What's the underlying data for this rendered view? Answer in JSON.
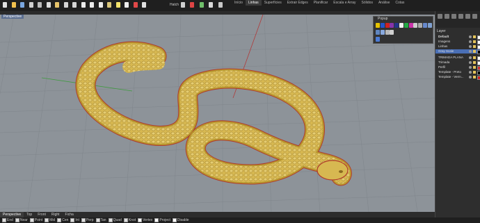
{
  "toolbar": {
    "hatch_label": "Hatch",
    "icons": [
      {
        "name": "new-icon",
        "color": "#e0e0e0"
      },
      {
        "name": "open-icon",
        "color": "#f2c14e"
      },
      {
        "name": "save-icon",
        "color": "#7aa7e0"
      },
      {
        "name": "print-icon",
        "color": "#cfcfcf"
      },
      {
        "name": "cut-icon",
        "color": "#bbbbbb"
      },
      {
        "name": "copy-icon",
        "color": "#dddddd"
      },
      {
        "name": "paste-icon",
        "color": "#e6c36a"
      },
      {
        "name": "undo-icon",
        "color": "#d6d6d6"
      },
      {
        "name": "redo-icon",
        "color": "#d6d6d6"
      },
      {
        "name": "pan-icon",
        "color": "#eaeaea"
      },
      {
        "name": "rotate-icon",
        "color": "#eaeaea"
      },
      {
        "name": "zoom-icon",
        "color": "#eaeaea"
      },
      {
        "name": "select-icon",
        "color": "#d9c67a"
      },
      {
        "name": "light-icon",
        "color": "#f4e36b"
      },
      {
        "name": "properties-icon",
        "color": "#eeeeee"
      },
      {
        "name": "record-icon",
        "color": "#e04848"
      },
      {
        "name": "layer-icon",
        "color": "#e0e0e0"
      },
      {
        "name": "box-icon",
        "color": "#cfcfcf"
      },
      {
        "name": "material-icon",
        "color": "#dd4444"
      },
      {
        "name": "render-icon",
        "color": "#6fbf6a"
      },
      {
        "name": "gumball-icon",
        "color": "#d9d9d9"
      },
      {
        "name": "settings-icon",
        "color": "#c8c8c8"
      }
    ]
  },
  "menu_tabs": [
    "Início",
    "Linhas",
    "Superfícies",
    "Extrair Edges",
    "Planificar",
    "Escala e Array",
    "Sólidos",
    "Análise",
    "Cotas"
  ],
  "active_menu": 1,
  "viewport": {
    "title": "Perspective"
  },
  "view_tabs": [
    "Perspective",
    "Top",
    "Front",
    "Right",
    "Ficha"
  ],
  "active_view": 0,
  "popup": {
    "title": "Popup",
    "icons": [
      {
        "name": "color-yellow-icon",
        "color": "#e6c300"
      },
      {
        "name": "color-blue-icon",
        "color": "#2255cc"
      },
      {
        "name": "color-red-icon",
        "color": "#cc2222"
      },
      {
        "name": "color-purple-icon",
        "color": "#8833aa"
      },
      {
        "name": "color-navy-icon",
        "color": "#223388"
      },
      {
        "name": "color-white-icon",
        "color": "#f0f0f0"
      },
      {
        "name": "color-green-icon",
        "color": "#22aa44"
      },
      {
        "name": "color-magenta-icon",
        "color": "#cc33aa"
      },
      {
        "name": "grid-icon",
        "color": "#cccccc"
      },
      {
        "name": "shade-icon",
        "color": "#aaaaaa"
      },
      {
        "name": "cube-icon",
        "color": "#6688cc"
      },
      {
        "name": "sphere-icon",
        "color": "#7fa0d0"
      },
      {
        "name": "cylinder-icon",
        "color": "#5f86c0"
      },
      {
        "name": "cone-icon",
        "color": "#88a8dd"
      },
      {
        "name": "torus-icon",
        "color": "#b8b8b8"
      },
      {
        "name": "pipe-icon",
        "color": "#d0d0d0"
      },
      {
        "name": "material-ball-icon",
        "color": "#4b7bd6"
      }
    ]
  },
  "layers": {
    "header": "Layer",
    "items": [
      {
        "name": "Default",
        "color": "#ffffff",
        "bold": true
      },
      {
        "name": "Imagens",
        "color": "#ffffff"
      },
      {
        "name": "Linhas",
        "color": "#ffffff"
      },
      {
        "name": "Gray Scale",
        "color": "#000000",
        "selected": true
      },
      {
        "name": "TRIMADA PLANA",
        "color": "#ffffff"
      },
      {
        "name": "Trimada",
        "color": "#ffffff"
      },
      {
        "name": "Perfil",
        "color": "#cc3333"
      },
      {
        "name": "Template - Preto",
        "color": "#000000"
      },
      {
        "name": "Template - Verm...",
        "color": "#cc2222"
      }
    ]
  },
  "osnaps": [
    {
      "label": "End",
      "on": true
    },
    {
      "label": "Near",
      "on": true
    },
    {
      "label": "Point",
      "on": true
    },
    {
      "label": "Mid",
      "on": true
    },
    {
      "label": "Cen",
      "on": true
    },
    {
      "label": "Int",
      "on": true
    },
    {
      "label": "Perp",
      "on": true
    },
    {
      "label": "Tan",
      "on": true
    },
    {
      "label": "Quad",
      "on": true
    },
    {
      "label": "Knot",
      "on": true
    },
    {
      "label": "Vertex",
      "on": false
    },
    {
      "label": "Project",
      "on": false
    },
    {
      "label": "Disable",
      "on": false
    }
  ]
}
